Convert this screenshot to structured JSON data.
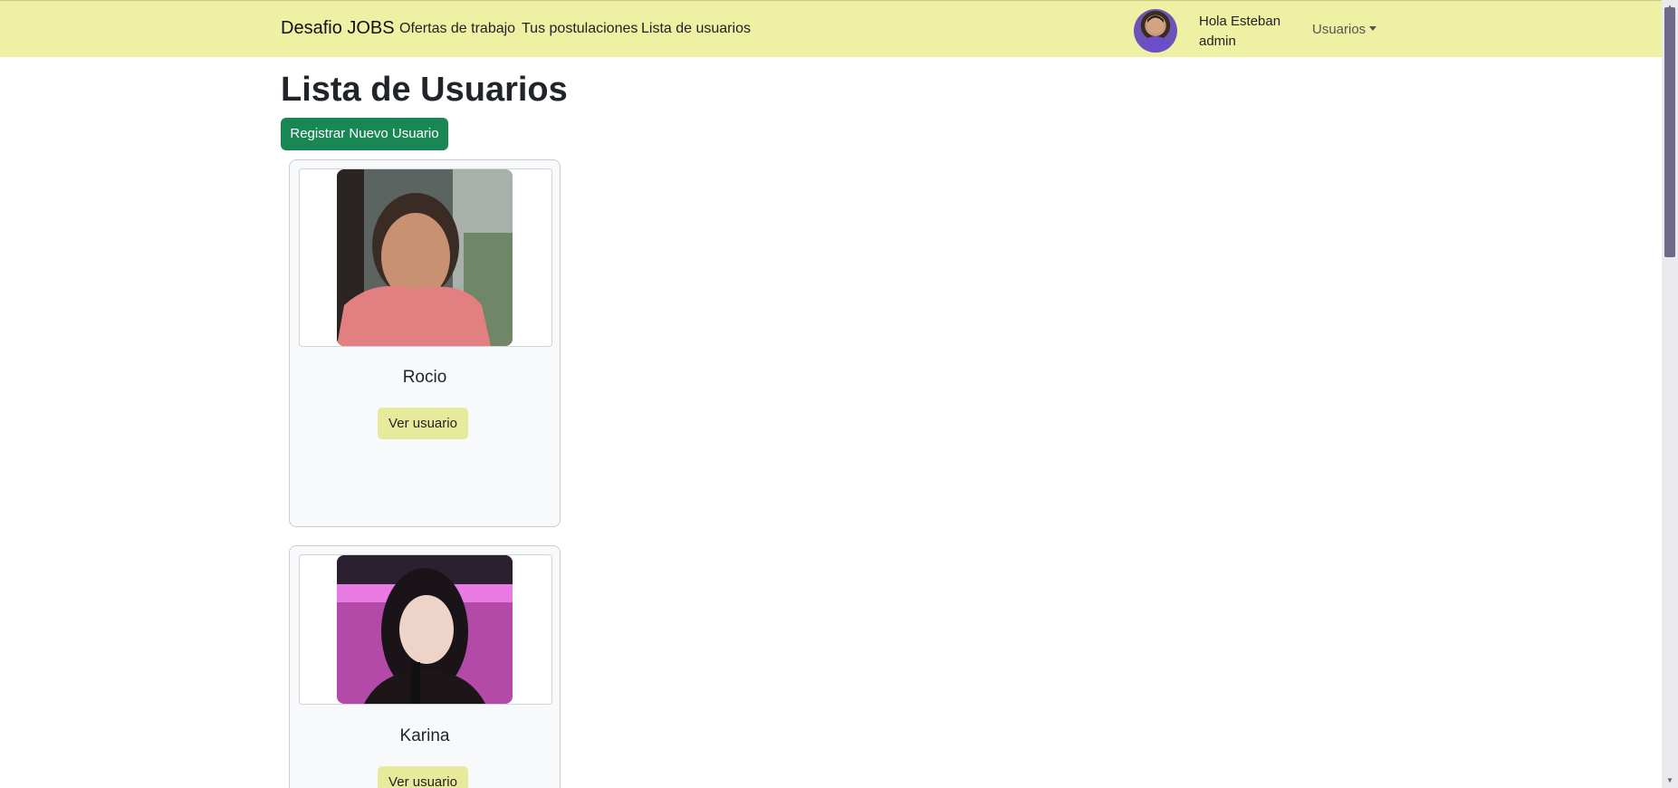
{
  "navbar": {
    "brand": "Desafio JOBS",
    "links": [
      "Ofertas de trabajo",
      "Tus postulaciones",
      "Lista de usuarios"
    ],
    "greeting": "Hola Esteban",
    "role": "admin",
    "dropdown_label": "Usuarios",
    "colors": {
      "background": "#eef1a3"
    }
  },
  "main": {
    "title": "Lista de Usuarios",
    "register_button": "Registrar Nuevo Usuario",
    "users": [
      {
        "name": "Rocio",
        "button": "Ver usuario"
      },
      {
        "name": "Karina",
        "button": "Ver usuario"
      }
    ],
    "colors": {
      "primary_button": "#198754",
      "view_button": "#e6ea9a"
    }
  },
  "icons": {
    "dropdown": "caret-down-icon",
    "scroll_up": "scroll-up-arrow-icon",
    "scroll_down": "scroll-down-arrow-icon"
  }
}
